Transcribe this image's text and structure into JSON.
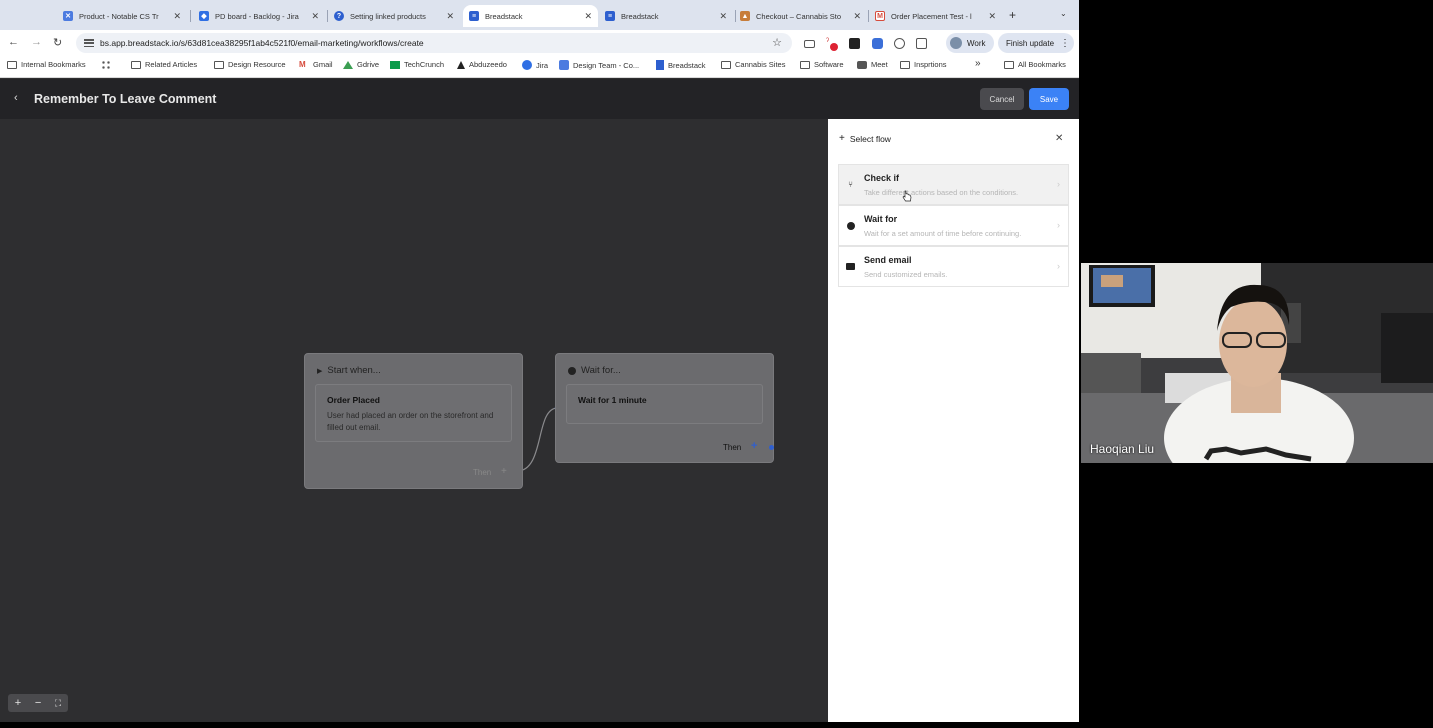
{
  "browser": {
    "tabs": [
      {
        "label": "Product - Notable CS Tr",
        "icon": "jira-icon",
        "color": "#4c7be0"
      },
      {
        "label": "PD board - Backlog - Jira",
        "icon": "jira-icon",
        "color": "#2f6fe4"
      },
      {
        "label": "Setting linked products",
        "icon": "help-icon",
        "color": "#2d5fcf"
      },
      {
        "label": "Breadstack",
        "icon": "breadstack-icon",
        "color": "#2d5fcf",
        "active": true
      },
      {
        "label": "Breadstack",
        "icon": "breadstack-icon",
        "color": "#2d5fcf"
      },
      {
        "label": "Checkout – Cannabis Sto",
        "icon": "store-icon",
        "color": "#c77d3a"
      },
      {
        "label": "Order Placement Test - l",
        "icon": "gmail-icon",
        "color": "#d64b3c"
      }
    ],
    "url": "bs.app.breadstack.io/s/63d81cea38295f1ab4c521f0/email-marketing/workflows/create",
    "profile_label": "Work",
    "finish_update_label": "Finish update",
    "bookmarks": [
      {
        "label": "Internal Bookmarks",
        "icon": "folder"
      },
      {
        "label": "",
        "icon": "grid"
      },
      {
        "label": "Related Articles",
        "icon": "folder"
      },
      {
        "label": "Design Resource",
        "icon": "folder"
      },
      {
        "label": "Gmail",
        "icon": "gmail"
      },
      {
        "label": "Gdrive",
        "icon": "drive"
      },
      {
        "label": "TechCrunch",
        "icon": "techcrunch"
      },
      {
        "label": "Abduzeedo",
        "icon": "abduzeedo"
      },
      {
        "label": "Jira",
        "icon": "jira"
      },
      {
        "label": "Design Team - Co...",
        "icon": "jira"
      },
      {
        "label": "Breadstack",
        "icon": "breadstack"
      },
      {
        "label": "Cannabis Sites",
        "icon": "folder"
      },
      {
        "label": "Software",
        "icon": "folder"
      },
      {
        "label": "Meet",
        "icon": "meet"
      },
      {
        "label": "Insprtions",
        "icon": "folder"
      },
      {
        "label": "»",
        "icon": "none"
      },
      {
        "label": "All Bookmarks",
        "icon": "folder"
      }
    ]
  },
  "app": {
    "title": "Remember To Leave Comment",
    "cancel_label": "Cancel",
    "save_label": "Save"
  },
  "canvas": {
    "start_node": {
      "header": "Start when...",
      "body_title": "Order Placed",
      "body_desc": "User had placed an order on the storefront and filled out email.",
      "footer": "Then"
    },
    "wait_node": {
      "header": "Wait for...",
      "body_title": "Wait for 1 minute",
      "footer": "Then"
    },
    "zoom": {
      "plus": "+",
      "minus": "−",
      "fit": "⛶"
    }
  },
  "panel": {
    "title": "Select flow",
    "options": [
      {
        "title": "Check if",
        "desc": "Take different actions based on the conditions.",
        "icon": "branch-icon"
      },
      {
        "title": "Wait for",
        "desc": "Wait for a set amount of time before continuing.",
        "icon": "clock-icon"
      },
      {
        "title": "Send email",
        "desc": "Send customized emails.",
        "icon": "mail-icon"
      }
    ]
  },
  "webcam": {
    "participant_name": "Haoqian Liu"
  }
}
